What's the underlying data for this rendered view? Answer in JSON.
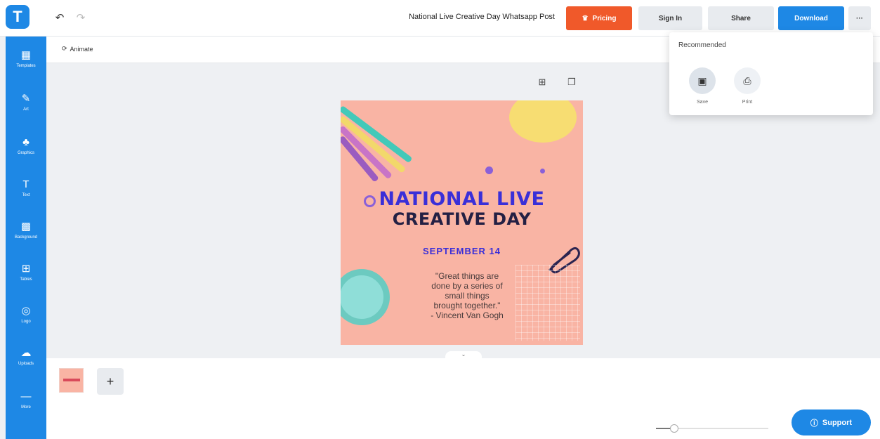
{
  "app": {
    "logo_letter": "T"
  },
  "header": {
    "title": "National Live Creative Day Whatsapp Post",
    "pricing_label": "Pricing",
    "signin_label": "Sign In",
    "share_label": "Share",
    "download_label": "Download",
    "more_label": "···"
  },
  "sidebar": {
    "items": [
      {
        "label": "Templates",
        "icon": "▦"
      },
      {
        "label": "Art",
        "icon": "✎"
      },
      {
        "label": "Graphics",
        "icon": "♣"
      },
      {
        "label": "Text",
        "icon": "T"
      },
      {
        "label": "Background",
        "icon": "▩"
      },
      {
        "label": "Tables",
        "icon": "⊞"
      },
      {
        "label": "Logo",
        "icon": "◎"
      },
      {
        "label": "Uploads",
        "icon": "☁"
      },
      {
        "label": "More",
        "icon": "—"
      }
    ]
  },
  "toolbar": {
    "animate_label": "Animate"
  },
  "design": {
    "title_line1": "NATIONAL LIVE",
    "title_line2": "CREATIVE DAY",
    "date": "SEPTEMBER 14",
    "quote_line1": "\"Great things are",
    "quote_line2": "done by a series of",
    "quote_line3": "small things",
    "quote_line4": "brought together.\"",
    "quote_line5": "- Vincent Van Gogh"
  },
  "dropdown": {
    "title": "Recommended",
    "options": [
      {
        "label": "Save",
        "icon": "save-icon"
      },
      {
        "label": "Print",
        "icon": "print-icon"
      }
    ]
  },
  "pages": {
    "add_label": "+"
  },
  "support": {
    "label": "Support"
  },
  "colors": {
    "accent": "#1e88e5",
    "pricing": "#f0592a",
    "design_bg": "#f9b4a4",
    "title_blue": "#3a2fd8"
  }
}
